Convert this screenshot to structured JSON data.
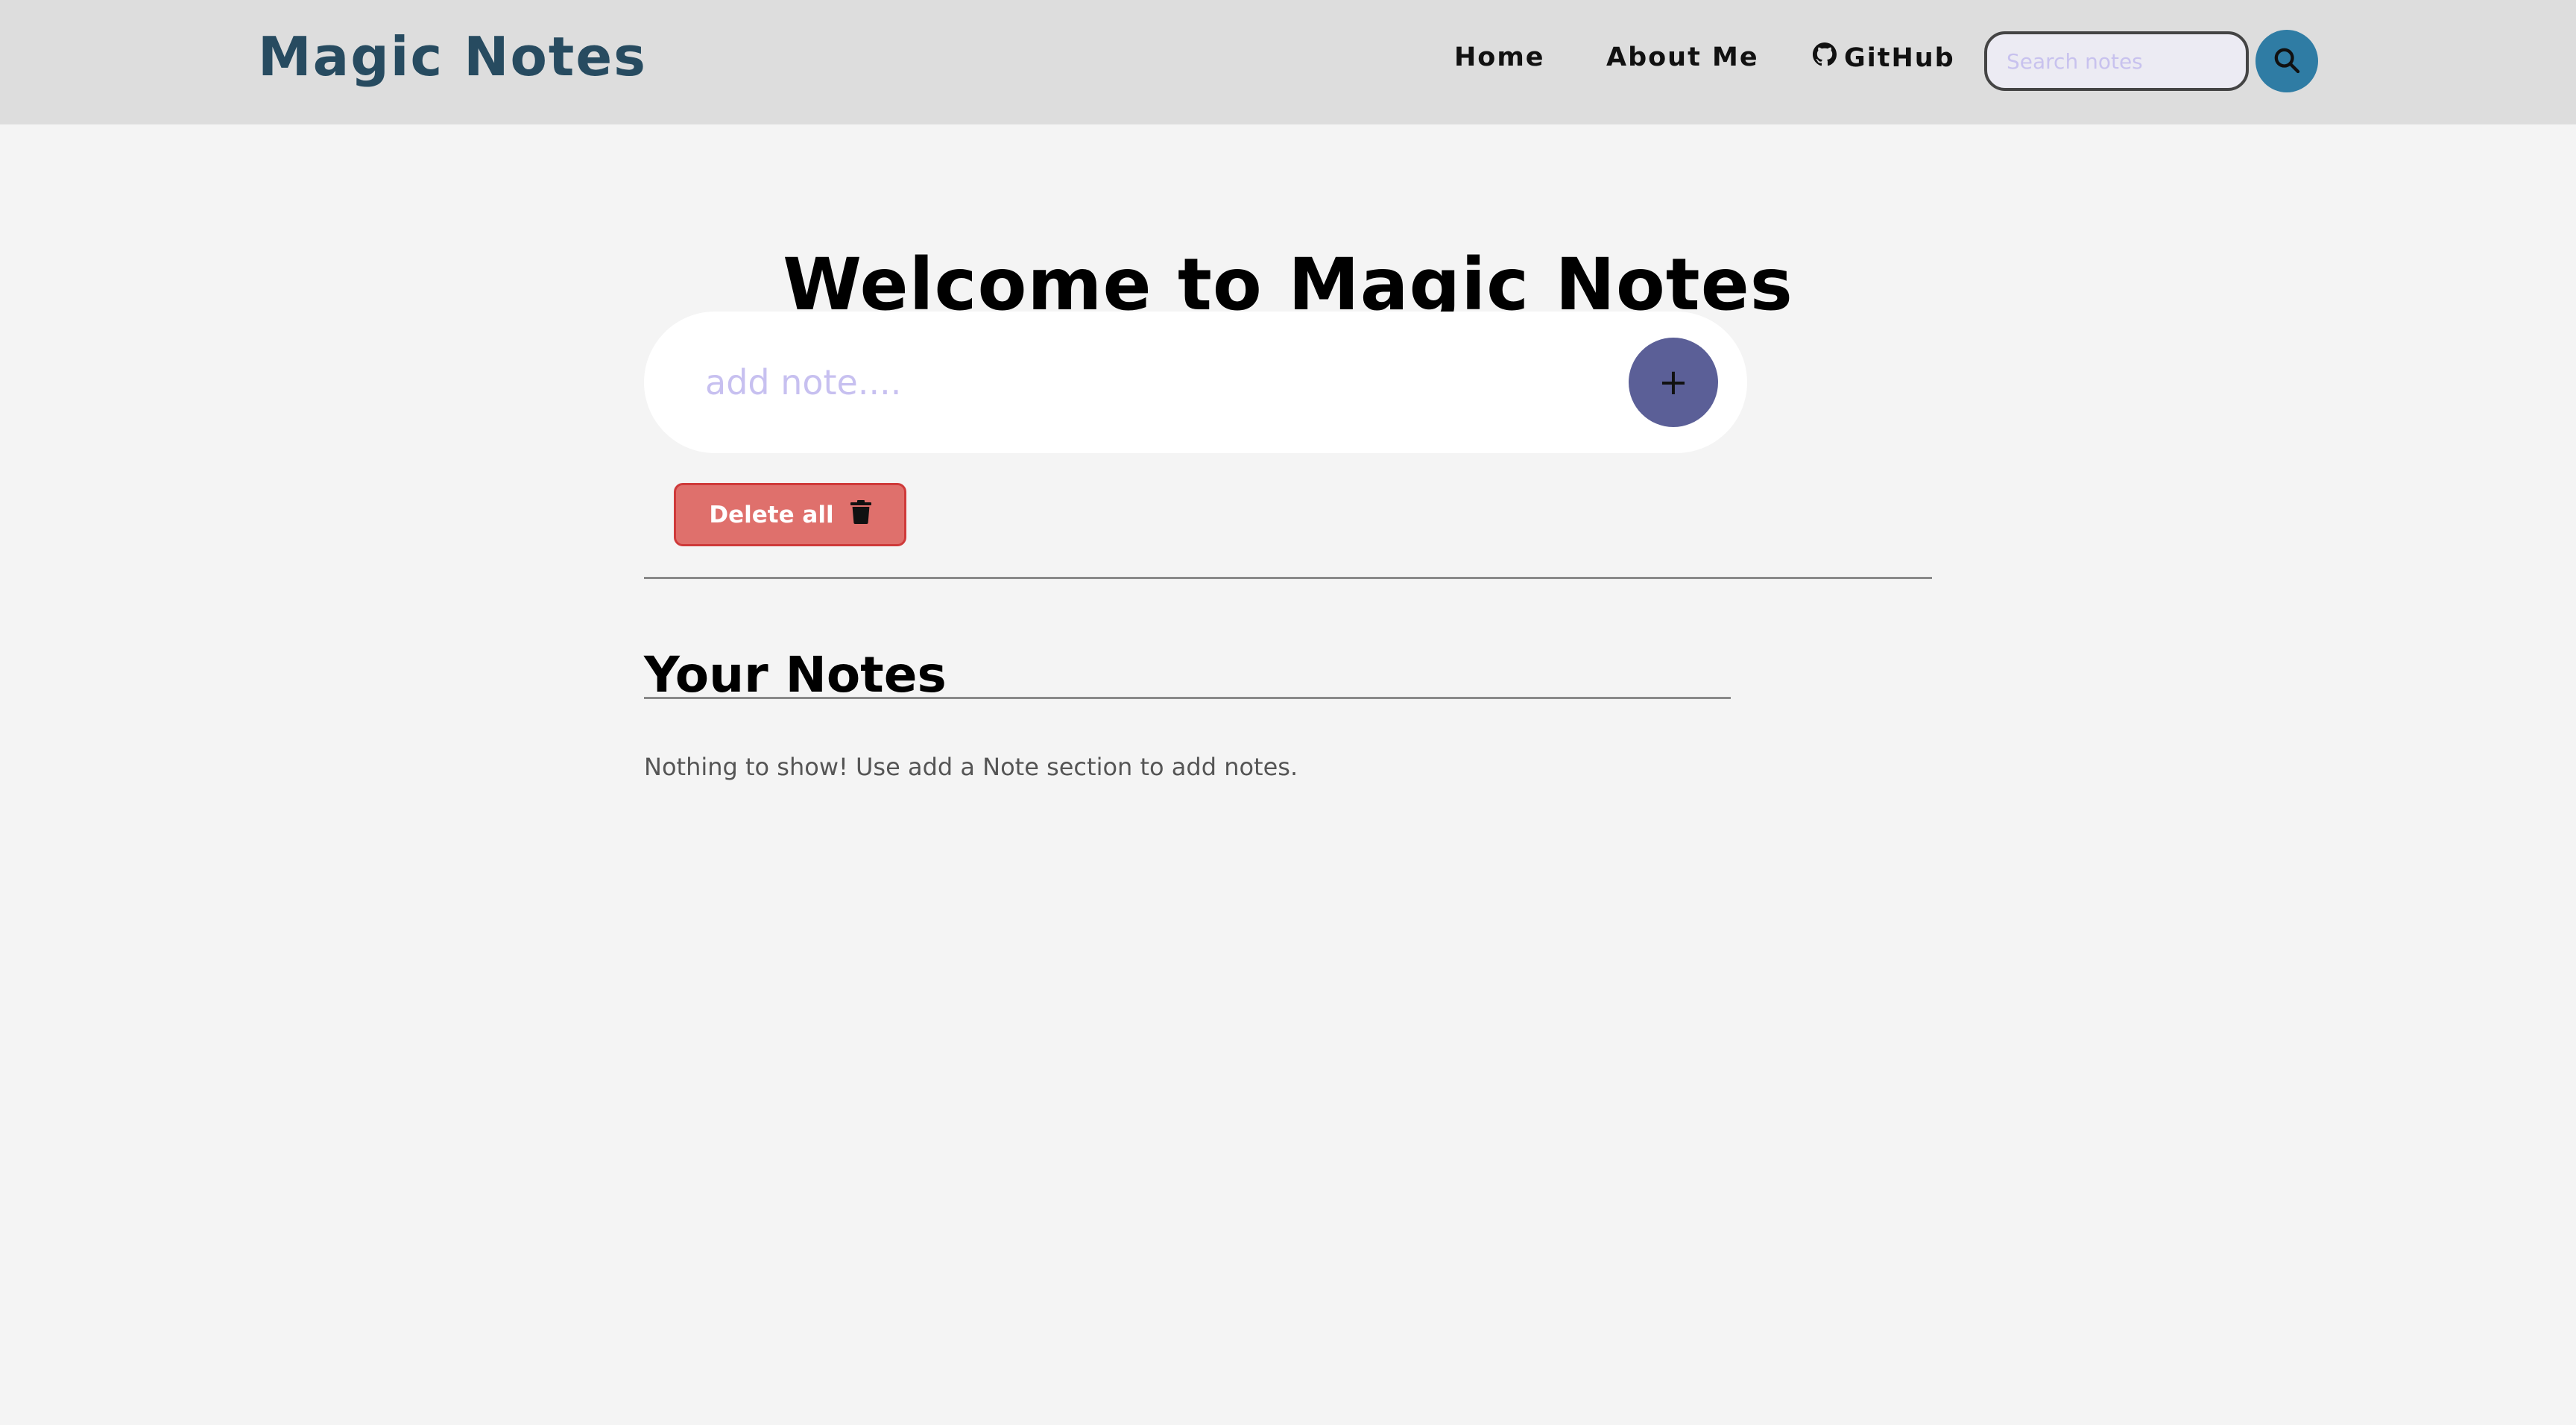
{
  "header": {
    "brand": "Magic Notes",
    "nav": {
      "home": "Home",
      "about": "About Me",
      "github": "GitHub"
    },
    "search": {
      "placeholder": "Search notes",
      "button_icon": "search-icon"
    }
  },
  "main": {
    "title": "Welcome to Magic Notes",
    "add_note": {
      "placeholder": "add note....",
      "add_button_label": "+"
    },
    "delete_all": {
      "label": "Delete all",
      "icon": "trash-icon"
    },
    "notes_heading": "Your Notes",
    "empty_message": "Nothing to show! Use add a Note section to add notes."
  },
  "colors": {
    "brand": "#274b60",
    "navbar_bg": "#dddddd",
    "page_bg": "#f4f4f4",
    "search_button": "#2f7ca4",
    "add_button": "#5b5f97",
    "delete_button": "#df706c",
    "placeholder": "#c7c0f0"
  }
}
